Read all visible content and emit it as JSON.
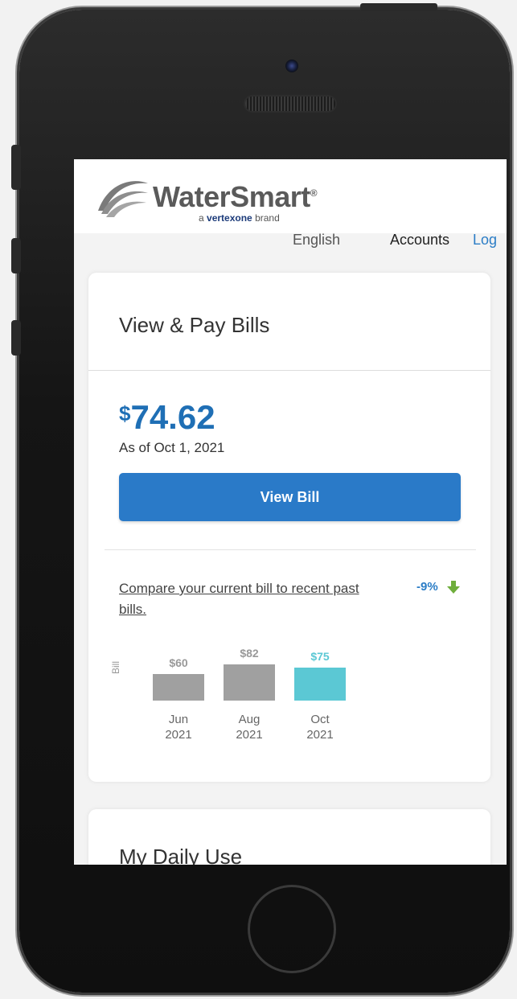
{
  "header": {
    "brand": "WaterSmart",
    "brand_mark": "®",
    "tag_prefix": "a",
    "tag_vertex": "vertexone",
    "tag_suffix": "brand"
  },
  "nav": {
    "language": "English",
    "accounts": "Accounts",
    "logout": "Log"
  },
  "bills": {
    "title": "View & Pay Bills",
    "currency": "$",
    "amount": "74.62",
    "as_of": "As of Oct 1, 2021",
    "view_bill_label": "View Bill",
    "compare_text": "Compare your current bill to recent past bills.",
    "change": "-9%",
    "axis_label": "Bill",
    "history": [
      {
        "value": "$60",
        "month": "Jun",
        "year": "2021",
        "amount": 60
      },
      {
        "value": "$82",
        "month": "Aug",
        "year": "2021",
        "amount": 82
      },
      {
        "value": "$75",
        "month": "Oct",
        "year": "2021",
        "amount": 75
      }
    ],
    "past_color": "#a0a0a0",
    "current_color": "#5bc8d4"
  },
  "daily": {
    "title": "My Daily Use"
  },
  "colors": {
    "accent": "#2a7ac8",
    "amount": "#1f6fb5",
    "down_arrow": "#6fae3c"
  }
}
